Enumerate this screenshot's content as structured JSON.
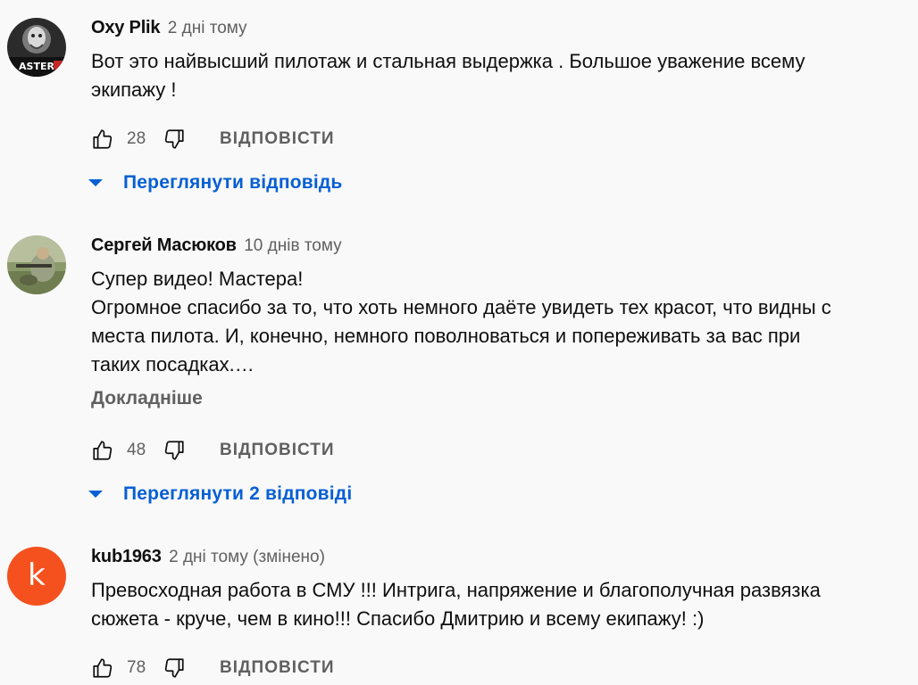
{
  "comments": [
    {
      "author": "Oxy Plik",
      "time": "2 дні тому",
      "text": "Вот это найвысший пилотаж и стальная выдержка . Большое уважение всему\nэкипажу !",
      "likes": "28",
      "reply_label": "ВІДПОВІСТИ",
      "view_replies": "Переглянути відповідь",
      "avatar_text": "ASTER"
    },
    {
      "author": "Сергей Масюков",
      "time": "10 днів тому",
      "text": "Супер видео! Мастера!\nОгромное спасибо за то, что хоть немного даёте увидеть тех красот, что видны с\nместа пилота. И, конечно, немного поволноваться и попереживать за вас при\nтаких посадках.…",
      "more_label": "Докладніше",
      "likes": "48",
      "reply_label": "ВІДПОВІСТИ",
      "view_replies": "Переглянути 2 відповіді"
    },
    {
      "author": "kub1963",
      "time": "2 дні тому (змінено)",
      "avatar_letter": "k",
      "text": "Превосходная работа в СМУ !!!  Интрига, напряжение и благополучная  развязка\nсюжета - круче, чем в кино!!! Спасибо Дмитрию и всему екипажу! :)",
      "likes": "78",
      "reply_label": "ВІДПОВІСТИ"
    }
  ],
  "colors": {
    "background": "#f9f9f9",
    "link_blue": "#065fd4",
    "secondary_text": "#606060",
    "avatar_k": "#f4511e"
  },
  "icons": {
    "like": "thumbs-up-icon",
    "dislike": "thumbs-down-icon",
    "expand": "caret-down-icon"
  }
}
